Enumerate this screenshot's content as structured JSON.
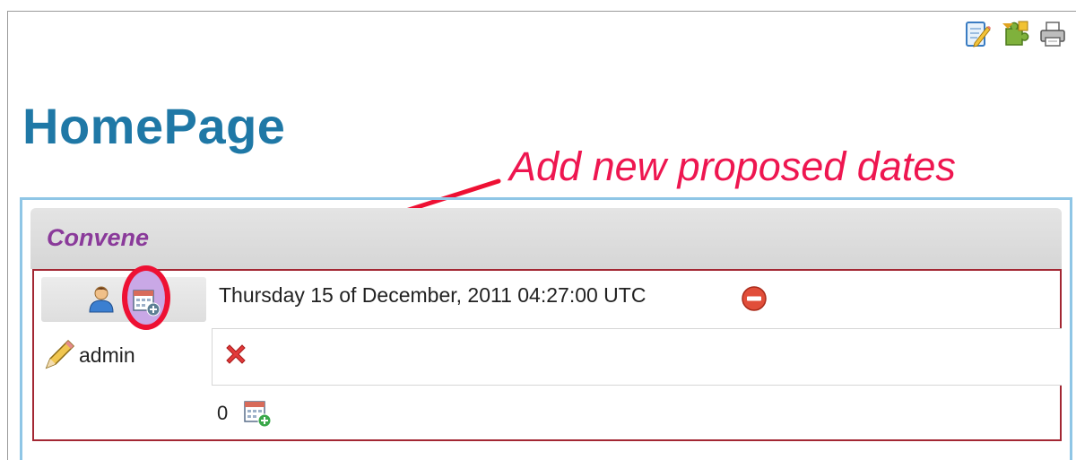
{
  "page": {
    "title": "HomePage"
  },
  "page_actions": {
    "icons": [
      "edit-page-icon",
      "plugin-add-icon",
      "print-icon"
    ]
  },
  "annotation": {
    "text": "Add new proposed dates",
    "color": "#ee1650"
  },
  "convene": {
    "title": "Convene",
    "proposed_date": "Thursday 15 of December, 2011 04:27:00 UTC",
    "participant": "admin",
    "vote_total": "0"
  },
  "colors": {
    "title_blue": "#1f78a6",
    "convene_purple": "#8a3a9a",
    "box_border": "#a32733",
    "outer_border": "#8fc6e6"
  }
}
